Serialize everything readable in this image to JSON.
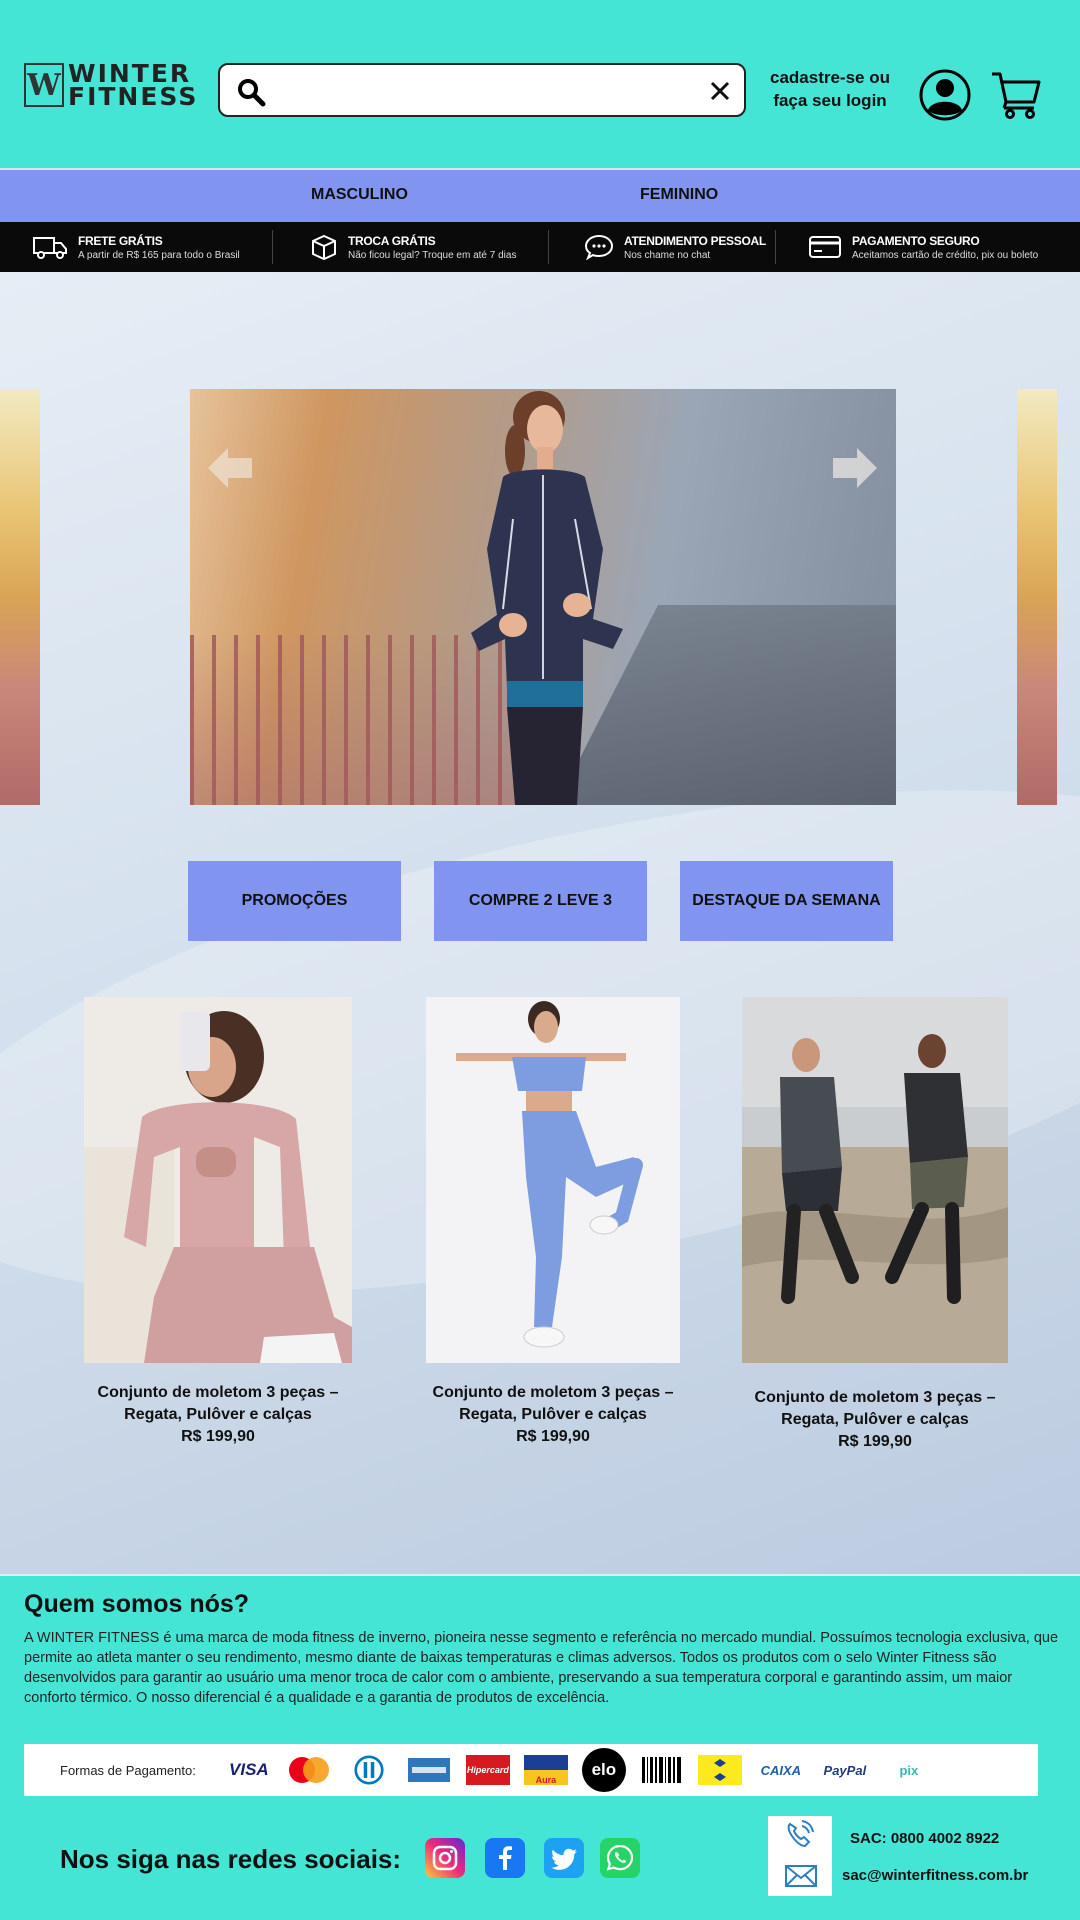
{
  "header": {
    "logo_line1": "WINTER",
    "logo_line2": "FITNESS",
    "logo_mark": "W",
    "search_placeholder": "",
    "login_line1": "cadastre-se ou",
    "login_line2": "faça seu login",
    "icons": [
      "search-icon",
      "close-icon",
      "user-icon",
      "cart-icon"
    ],
    "bg_color": "#45e5d6"
  },
  "nav": {
    "items": [
      "MASCULINO",
      "FEMININO"
    ],
    "bg_color": "#8094f0"
  },
  "infobar": {
    "items": [
      {
        "icon": "truck-icon",
        "title": "FRETE GRÁTIS",
        "subtitle": "A partir de R$ 165 para todo o Brasil"
      },
      {
        "icon": "box-icon",
        "title": "TROCA GRÁTIS",
        "subtitle": "Não ficou legal? Troque em até 7 dias"
      },
      {
        "icon": "chat-icon",
        "title": "ATENDIMENTO PESSOAL",
        "subtitle": "Nos chame no chat"
      },
      {
        "icon": "card-icon",
        "title": "PAGAMENTO SEGURO",
        "subtitle": "Aceitamos cartão de crédito, pix ou boleto"
      }
    ]
  },
  "carousel": {
    "prev_icon": "arrow-left-icon",
    "next_icon": "arrow-right-icon"
  },
  "categories": [
    "PROMOÇÕES",
    "COMPRE 2 LEVE 3",
    "DESTAQUE DA SEMANA"
  ],
  "products": [
    {
      "name_line1": "Conjunto de moletom 3 peças –",
      "name_line2": "Regata, Pulôver e calças",
      "price": "R$ 199,90"
    },
    {
      "name_line1": "Conjunto de moletom 3 peças –",
      "name_line2": "Regata, Pulôver e calças",
      "price": "R$ 199,90"
    },
    {
      "name_line1": "Conjunto de moletom 3 peças –",
      "name_line2": "Regata, Pulôver e calças",
      "price": "R$ 199,90"
    }
  ],
  "footer": {
    "about_title": "Quem somos nós?",
    "about_text": "A WINTER FITNESS é uma marca de moda fitness de inverno, pioneira nesse segmento e referência no mercado mundial. Possuímos tecnologia exclusiva, que permite ao atleta manter o seu rendimento, mesmo diante de baixas temperaturas e climas adversos. Todos os produtos com o selo Winter Fitness são desenvolvidos para garantir ao usuário uma menor troca de calor com o ambiente, preservando a sua temperatura corporal e garantindo assim, um maior conforto térmico. O nosso diferencial é a qualidade e a garantia de produtos de excelência.",
    "payments_label": "Formas de Pagamento:",
    "payments": [
      "VISA",
      "Hipercard",
      "Aura",
      "elo",
      "CAIXA",
      "PayPal",
      "pix"
    ],
    "social_title": "Nos siga nas redes sociais:",
    "social_icons": [
      "instagram-icon",
      "facebook-icon",
      "twitter-icon",
      "whatsapp-icon"
    ],
    "sac_phone": "SAC: 0800 4002 8922",
    "sac_email": "sac@winterfitness.com.br"
  }
}
